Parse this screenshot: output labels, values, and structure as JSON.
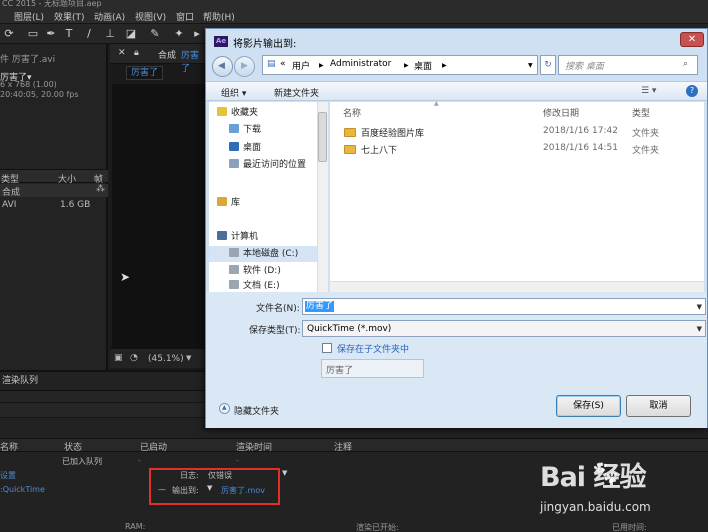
{
  "ae": {
    "window_title": "CC 2015 - 无标题项目.aep",
    "menu": [
      "图层(L)",
      "效果(T)",
      "动画(A)",
      "视图(V)",
      "窗口",
      "帮助(H)"
    ],
    "project": {
      "header": "件 厉害了.avi",
      "item_name": "厉害了▾",
      "dimensions": "6 x 768 (1.00)",
      "duration": "20:40:05, 20.00 fps",
      "columns": [
        "类型",
        "大小",
        "帧"
      ],
      "rows": [
        {
          "type": "合成",
          "size": ""
        },
        {
          "type": "AVI",
          "size": "1.6 GB"
        }
      ]
    },
    "composition": {
      "tab_prefix": "合成",
      "tab_name": "厉害了",
      "label": "厉害了",
      "zoom": "(45.1%)"
    },
    "render_queue": {
      "tab": "渲染队列",
      "columns": [
        "名称",
        "状态",
        "已启动",
        "渲染时间",
        "注释"
      ],
      "status": "已加入队列",
      "row_label_1": "设置",
      "row_label_2": ":QuickTime",
      "log_label": "日志:",
      "log_value": "仅错误",
      "output_label": "输出到:",
      "output_value": "厉害了.mov",
      "footer": [
        "RAM:",
        "渲染已开始:",
        "已用时间:"
      ]
    }
  },
  "dialog": {
    "title": "将影片输出到:",
    "close_glyph": "✕",
    "address": {
      "root": "«",
      "parts": [
        "用户",
        "Administrator",
        "桌面"
      ]
    },
    "search_placeholder": "搜索 桌面",
    "toolbar": {
      "organize": "组织 ▾",
      "new_folder": "新建文件夹"
    },
    "nav": {
      "favorites": "收藏夹",
      "items": [
        "下载",
        "桌面",
        "最近访问的位置"
      ],
      "libraries": "库",
      "computer": "计算机",
      "drives": [
        "本地磁盘 (C:)",
        "软件 (D:)",
        "文档 (E:)"
      ]
    },
    "columns": {
      "name": "名称",
      "date": "修改日期",
      "type": "类型"
    },
    "files": [
      {
        "name": "百度经验图片库",
        "date": "2018/1/16 17:42",
        "type": "文件夹"
      },
      {
        "name": "七上八下",
        "date": "2018/1/16 14:51",
        "type": "文件夹"
      }
    ],
    "filename_label": "文件名(N):",
    "filename_value": "厉害了",
    "filetype_label": "保存类型(T):",
    "filetype_value": "QuickTime (*.mov)",
    "subfolder_label": "保存在子文件夹中",
    "subfolder_value": "厉害了",
    "hide_folders": "隐藏文件夹",
    "save": "保存(S)",
    "cancel": "取消"
  },
  "watermark": {
    "logo": "Bai  经验",
    "url": "jingyan.baidu.com"
  },
  "colors": {
    "ae_bg": "#1d1d1d",
    "ae_link": "#4b8bd4",
    "dialog_chrome": "#cfe0f3",
    "selection": "#3399ff",
    "annotation_red": "#e0302a"
  }
}
